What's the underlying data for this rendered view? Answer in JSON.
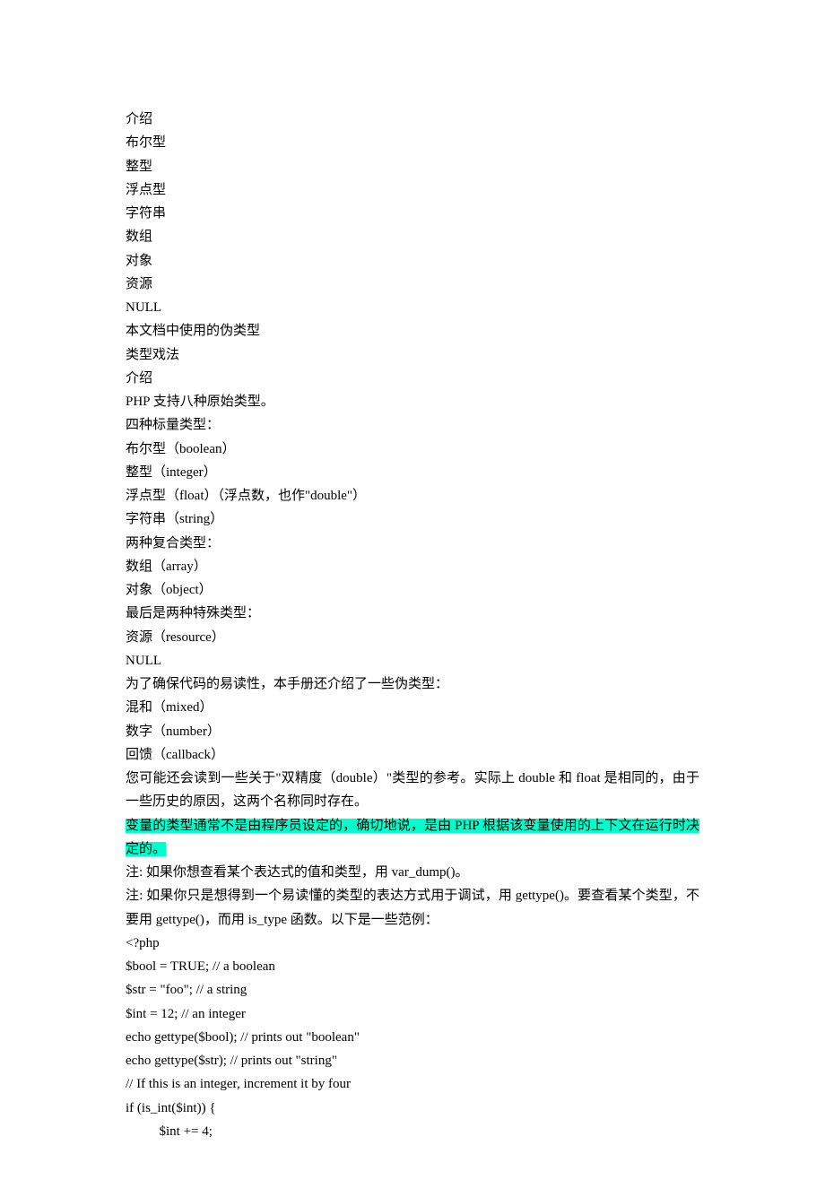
{
  "lines": [
    "介绍",
    "布尔型",
    "整型",
    "浮点型",
    "字符串",
    "数组",
    "对象",
    "资源",
    "NULL",
    "本文档中使用的伪类型",
    "类型戏法",
    "介绍",
    "PHP 支持八种原始类型。",
    "四种标量类型：",
    "布尔型（boolean）",
    "整型（integer）",
    "浮点型（float）（浮点数，也作\"double\"）",
    "字符串（string）",
    "两种复合类型：",
    "数组（array）",
    "对象（object）",
    "最后是两种特殊类型：",
    "资源（resource）",
    "NULL",
    "为了确保代码的易读性，本手册还介绍了一些伪类型：",
    "混和（mixed）",
    "数字（number）",
    "回馈（callback）",
    "您可能还会读到一些关于\"双精度（double）\"类型的参考。实际上 double 和 float 是相同的，由于一些历史的原因，这两个名称同时存在。"
  ],
  "highlighted": "变量的类型通常不是由程序员设定的，确切地说，是由 PHP 根据该变量使用的上下文在运行时决定的。",
  "after_highlight": [
    "注: 如果你想查看某个表达式的值和类型，用 var_dump()。",
    "注: 如果你只是想得到一个易读懂的类型的表达方式用于调试，用 gettype()。要查看某个类型，不要用 gettype()，而用 is_type 函数。以下是一些范例：",
    "<?php",
    "$bool = TRUE;      // a boolean",
    "$str    = \"foo\";    // a string",
    "$int    = 12;           // an integer",
    "echo gettype($bool); // prints out \"boolean\"",
    "echo gettype($str);    // prints out \"string\"",
    "// If this is an integer, increment it by four",
    "if (is_int($int)) {"
  ],
  "indented_code": "$int += 4;"
}
